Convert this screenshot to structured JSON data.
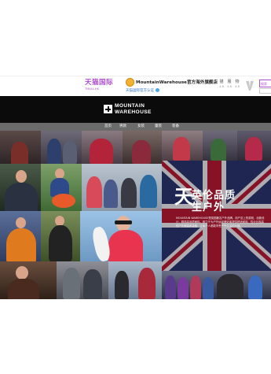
{
  "header": {
    "tmall_logo": {
      "cn": "天猫国际",
      "en": "TMALL.HK",
      "color": "#b04fd0"
    },
    "shop": {
      "name": "MountainWarehouse官方海外旗舰店",
      "cert_label": "天猫国际官方认证",
      "avatar_color": "#f4b233"
    },
    "ratings": [
      {
        "label": "描",
        "value": "4.8"
      },
      {
        "label": "服",
        "value": "4.8"
      },
      {
        "label": "物",
        "value": "4.8"
      }
    ],
    "search": {
      "placeholder": "搜索"
    }
  },
  "brand": {
    "line1": "MOUNTAIN",
    "line2": "WAREHOUSE",
    "bg_color": "#0b0b0b"
  },
  "nav": {
    "items": [
      {
        "label": "首页"
      },
      {
        "label": "男款"
      },
      {
        "label": "女装"
      },
      {
        "label": "童装"
      },
      {
        "label": "装备"
      }
    ]
  },
  "banner": {
    "big_char": "天",
    "slogan_line1": "英伦品质",
    "slogan_line2": "生户外",
    "intro": "MOUNTAIN WAREHOUSE是英国著名户外品牌，用户至上的原则，创新设计，精选高品质面料，致力于为户外运动爱好者提供舒适耐用、性价比极高的户外服装和装备，让每个人都能享受户外生活的乐趣。",
    "flag_colors": {
      "blue": "#23316a",
      "red": "#b3142b",
      "white": "#e9e9ee"
    }
  }
}
